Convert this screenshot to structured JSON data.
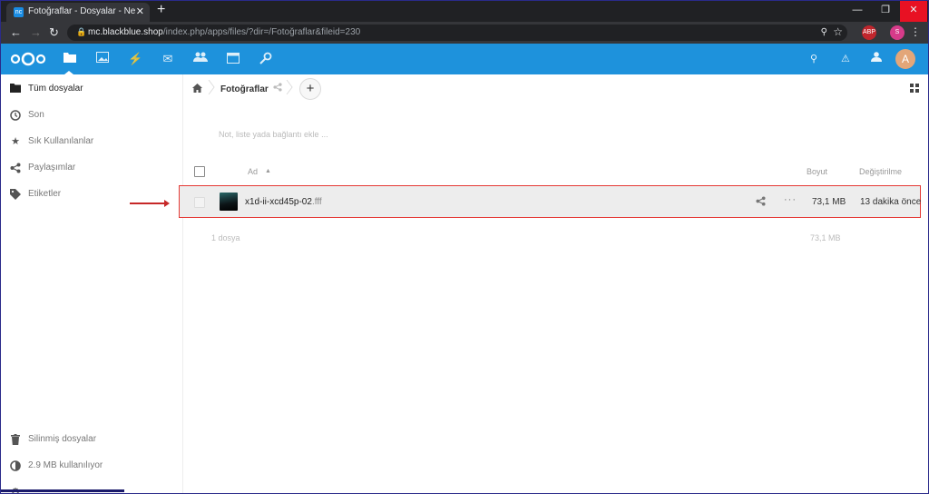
{
  "browser": {
    "tab_title": "Fotoğraflar - Dosyalar - Nextcloud",
    "tab_favicon_label": "nc",
    "close_tab_glyph": "✕",
    "new_tab_glyph": "+",
    "url_host": "mc.blackblue.shop",
    "url_path": "/index.php/apps/files/?dir=/Fotoğraflar&fileid=230",
    "ext1_label": "ABP",
    "ext2_label": "S"
  },
  "header": {
    "brand_color": "#1e92dc",
    "apps": [
      "folder-icon",
      "image-icon",
      "activity-icon",
      "mail-icon",
      "contacts-icon",
      "calendar-icon",
      "search-key-icon"
    ],
    "user_initial": "A"
  },
  "sidebar": {
    "items": [
      {
        "label": "Tüm dosyalar",
        "icon": "folder-icon"
      },
      {
        "label": "Son",
        "icon": "clock-icon"
      },
      {
        "label": "Sık Kullanılanlar",
        "icon": "star-icon"
      },
      {
        "label": "Paylaşımlar",
        "icon": "share-icon"
      },
      {
        "label": "Etiketler",
        "icon": "tag-icon"
      }
    ],
    "bottom": [
      {
        "label": "Silinmiş dosyalar",
        "icon": "trash-icon"
      },
      {
        "label": "2.9 MB kullanılıyor",
        "icon": "quota-icon"
      }
    ]
  },
  "breadcrumb": {
    "folder": "Fotoğraflar",
    "add_glyph": "+"
  },
  "note_placeholder": "Not, liste yada bağlantı ekle ...",
  "table": {
    "col_name": "Ad",
    "col_size": "Boyut",
    "col_modified": "Değiştirilme",
    "rows": [
      {
        "name": "x1d-ii-xcd45p-02",
        "extension": ".fff",
        "size": "73,1 MB",
        "modified": "13 dakika önce"
      }
    ],
    "summary_count": "1 dosya",
    "summary_size": "73,1 MB"
  },
  "annotation": {
    "highlight_color": "#e53935"
  }
}
